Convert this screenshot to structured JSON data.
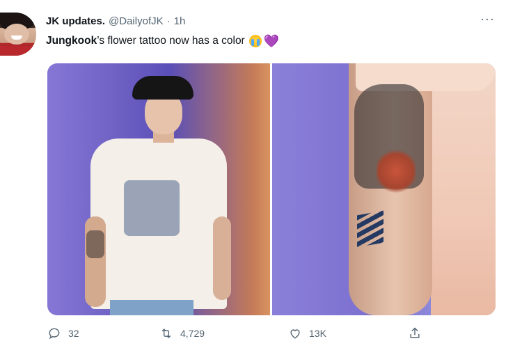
{
  "tweet": {
    "author_name": "JK updates.",
    "author_handle": "@DailyofJK",
    "separator": "·",
    "time": "1h",
    "more_label": "···",
    "text_bold": "Jungkook",
    "text_rest": "’s flower tattoo now has a color",
    "heart_emoji": "💜"
  },
  "media": {
    "images": [
      {
        "alt_subject": "jungkook-stage-photo"
      },
      {
        "alt_subject": "forearm-tattoo-closeup"
      }
    ]
  },
  "actions": {
    "reply_count": "32",
    "retweet_count": "4,729",
    "like_count": "13K"
  },
  "icons": {
    "reply": "speech-bubble-icon",
    "retweet": "retweet-icon",
    "like": "heart-icon",
    "share": "share-icon",
    "more": "more-dots-icon"
  },
  "colors": {
    "text_primary": "#0f1419",
    "text_secondary": "#536471",
    "heart_emoji": "#a77ee0"
  }
}
